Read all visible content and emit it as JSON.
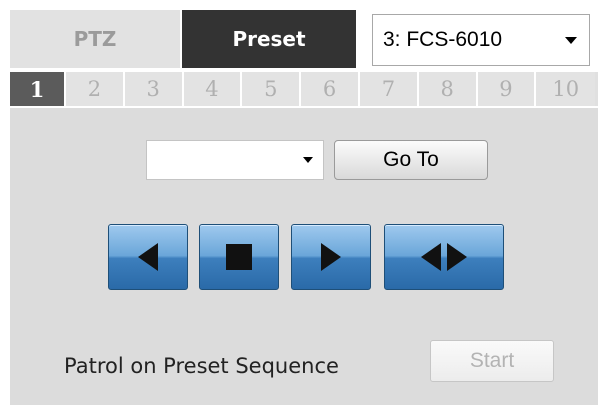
{
  "tabs": {
    "ptz_label": "PTZ",
    "preset_label": "Preset",
    "active": "Preset"
  },
  "camera_select": {
    "value": "3: FCS-6010"
  },
  "preset_numbers": [
    "1",
    "2",
    "3",
    "4",
    "5",
    "6",
    "7",
    "8",
    "9",
    "10"
  ],
  "active_number": "1",
  "preset_select": {
    "value": ""
  },
  "goto_button": {
    "label": "Go To"
  },
  "controls": {
    "left": "left-arrow-icon",
    "stop": "stop-icon",
    "right": "right-arrow-icon",
    "both": "left-right-arrows-icon"
  },
  "patrol": {
    "label": "Patrol on Preset Sequence",
    "start_label": "Start",
    "start_enabled": false
  },
  "colors": {
    "tab_active_bg": "#333333",
    "button_blue": "#3d7fbd",
    "panel_bg": "#dcdcdc"
  }
}
